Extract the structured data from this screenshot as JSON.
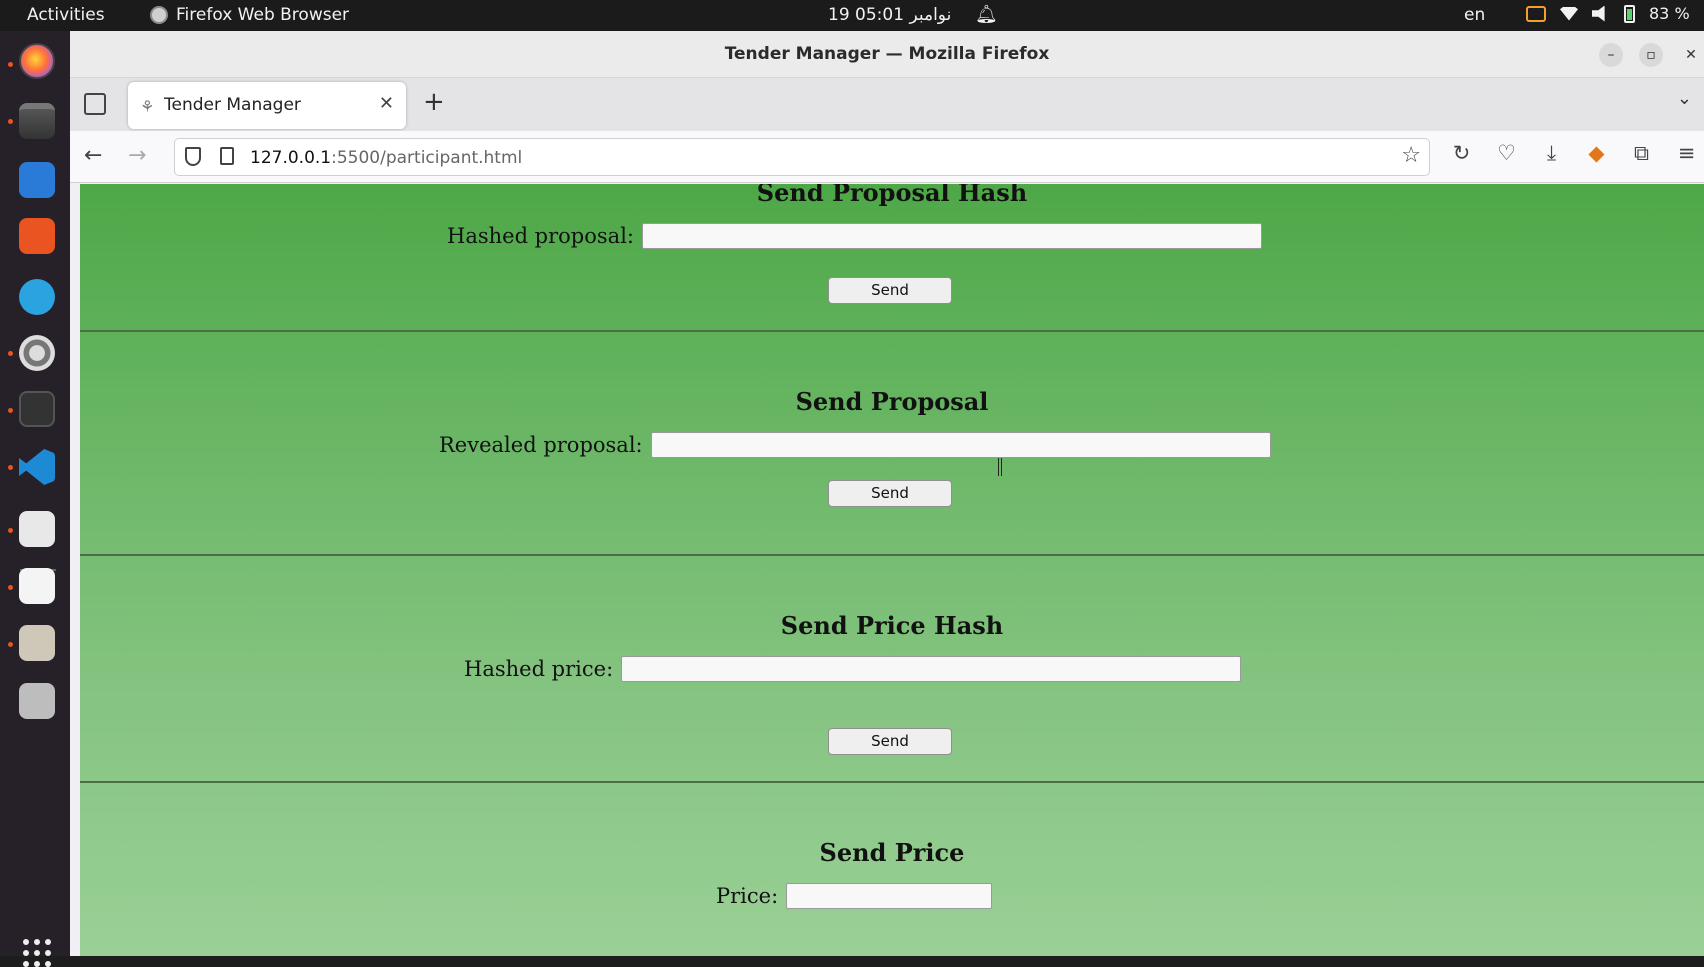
{
  "topbar": {
    "activities": "Activities",
    "app_name": "Firefox Web Browser",
    "clock": "19 نوامبر  05:01",
    "language": "en",
    "battery": "83 %"
  },
  "window": {
    "title": "Tender Manager — Mozilla Firefox"
  },
  "tabs": [
    {
      "label": "Tender Manager"
    }
  ],
  "address_bar": {
    "host": "127.0.0.1",
    "path": ":5500/participant.html"
  },
  "page": {
    "sections": [
      {
        "heading": "Send Proposal Hash",
        "label": "Hashed proposal:",
        "button": "Send"
      },
      {
        "heading": "Send Proposal",
        "label": "Revealed proposal:",
        "button": "Send"
      },
      {
        "heading": "Send Price Hash",
        "label": "Hashed price:",
        "button": "Send"
      },
      {
        "heading": "Send Price",
        "label": "Price:"
      }
    ]
  },
  "icons": {
    "dock": [
      "firefox-icon",
      "files-icon",
      "writer-icon",
      "app-center-icon",
      "telegram-icon",
      "settings-icon",
      "terminal-icon",
      "vscode-icon",
      "document-viewer-icon",
      "text-editor-icon",
      "archive-icon",
      "trash-icon",
      "app-grid-icon"
    ]
  }
}
